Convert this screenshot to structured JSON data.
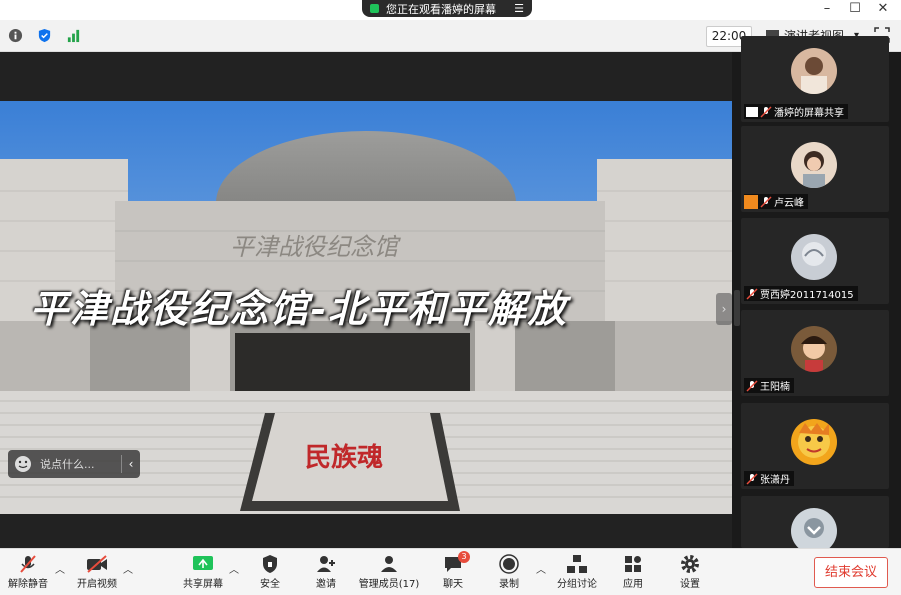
{
  "window": {
    "share_notice": "您正在观看潘婷的屏幕",
    "share_menu_icon": "menu-icon"
  },
  "topbar": {
    "time": "22:00",
    "view_label": "演讲者视图",
    "view_caret": "▾"
  },
  "video": {
    "overlay_title": "平津战役纪念馆-北平和平解放",
    "building_sign": "平津战役纪念馆",
    "stair_text": "民族魂"
  },
  "chat": {
    "placeholder": "说点什么...",
    "chevron": "‹"
  },
  "stage": {
    "collapse_arrow": "›"
  },
  "participants": [
    {
      "name": "潘婷的屏幕共享",
      "avatar_color": "#d8b8a0"
    },
    {
      "name": "卢云峰",
      "avatar_color": "#e9d8c8"
    },
    {
      "name": "贾西婷2011714015",
      "avatar_color": "#c8cdd4"
    },
    {
      "name": "王阳楠",
      "avatar_color": "#7a5a3a"
    },
    {
      "name": "张潇丹",
      "avatar_color": "#f2a51c"
    },
    {
      "name": "",
      "avatar_color": "#cfd6dc"
    }
  ],
  "toolbar": {
    "unmute": "解除静音",
    "start_video": "开启视频",
    "share_screen": "共享屏幕",
    "security": "安全",
    "invite": "邀请",
    "manage": "管理成员(17)",
    "chat": "聊天",
    "chat_badge": "3",
    "record": "录制",
    "breakout": "分组讨论",
    "apps": "应用",
    "settings": "设置",
    "end_meeting": "结束会议"
  },
  "colors": {
    "end_red": "#e03b2f",
    "share_green": "#1fc35a",
    "accent": "#0e72ed"
  }
}
